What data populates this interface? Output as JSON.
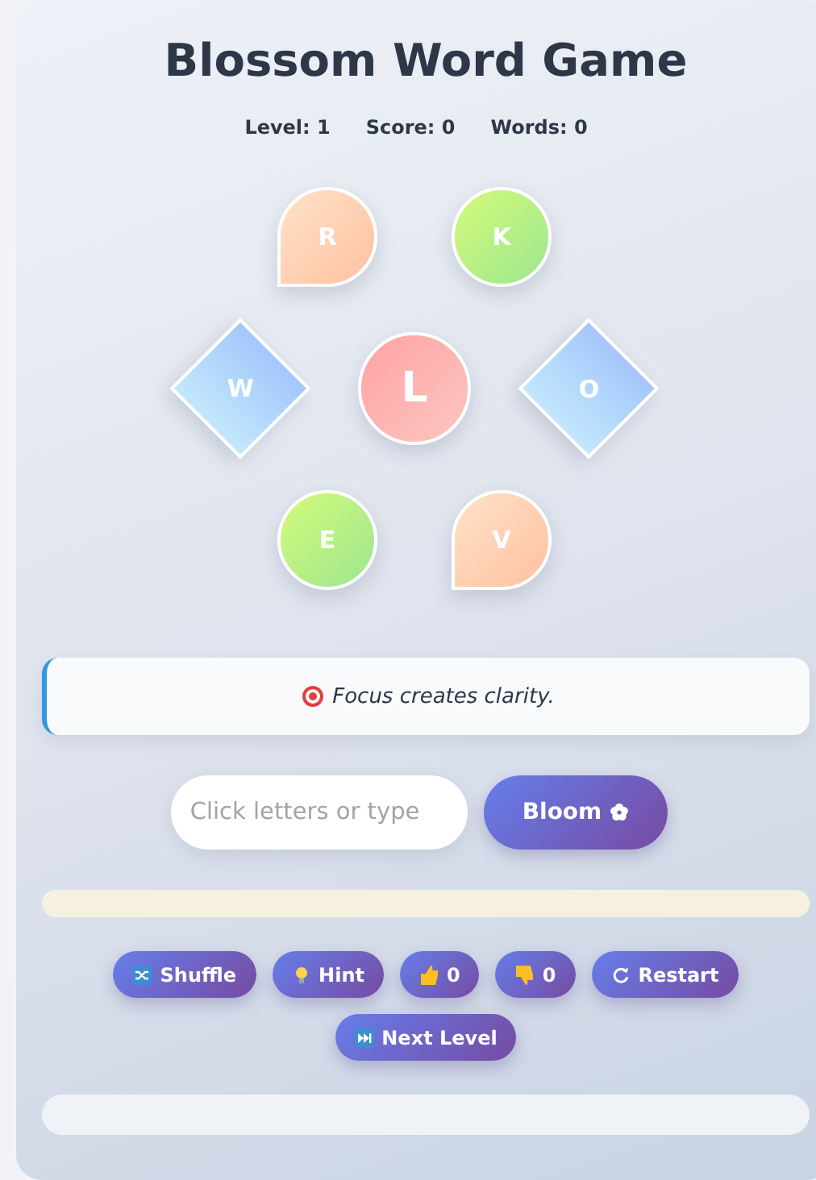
{
  "title": "Blossom Word Game",
  "stats": [
    "Level: 1",
    "Score: 0",
    "Words: 0"
  ],
  "tile_rows": [
    [
      {
        "letter": "R",
        "kind": "petal"
      },
      {
        "letter": "K",
        "kind": "circle"
      }
    ],
    [
      {
        "letter": "W",
        "kind": "diamond"
      },
      {
        "letter": "L",
        "kind": "center"
      },
      {
        "letter": "O",
        "kind": "diamond"
      }
    ],
    [
      {
        "letter": "E",
        "kind": "circle"
      },
      {
        "letter": "V",
        "kind": "petal"
      }
    ]
  ],
  "quote": "Focus creates clarity.",
  "input": {
    "placeholder": "Click letters or type"
  },
  "submit": {
    "label": "Bloom"
  },
  "actions": [
    {
      "kind": "shuffle",
      "label": "Shuffle"
    },
    {
      "kind": "hint",
      "label": "Hint"
    },
    {
      "kind": "like",
      "label": "0"
    },
    {
      "kind": "dislike",
      "label": "0"
    },
    {
      "kind": "restart",
      "label": "Restart"
    },
    {
      "kind": "next",
      "label": "Next Level"
    }
  ]
}
